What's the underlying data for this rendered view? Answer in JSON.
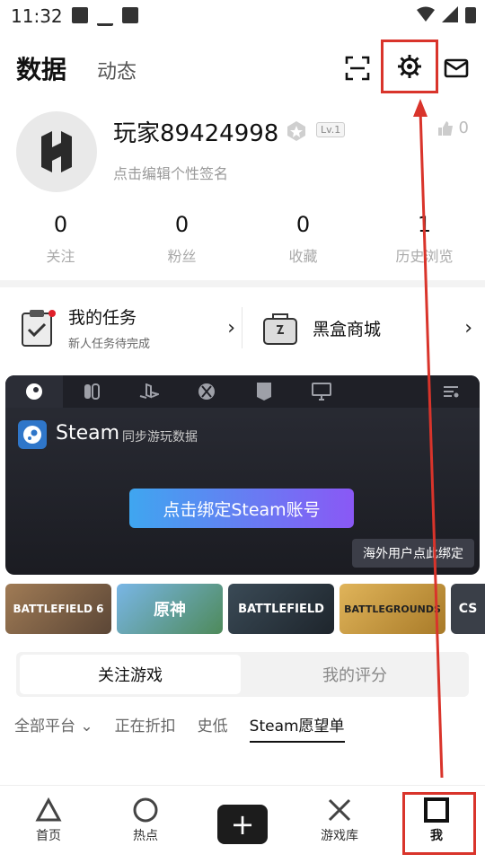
{
  "status": {
    "time": "11:32"
  },
  "header": {
    "tab_active": "数据",
    "tab_inactive": "动态"
  },
  "profile": {
    "username": "玩家89424998",
    "level": "Lv.1",
    "bio": "点击编辑个性签名",
    "likes": "0",
    "stats": [
      {
        "value": "0",
        "label": "关注"
      },
      {
        "value": "0",
        "label": "粉丝"
      },
      {
        "value": "0",
        "label": "收藏"
      },
      {
        "value": "1",
        "label": "历史浏览"
      }
    ]
  },
  "tasks": {
    "left_title": "我的任务",
    "left_sub": "新人任务待完成",
    "right_title": "黑盒商城"
  },
  "panel": {
    "tabs": [
      "steam",
      "switch",
      "playstation",
      "xbox",
      "epic",
      "pc",
      "menu"
    ],
    "title": "Steam",
    "subtitle": "同步游玩数据",
    "bind_button": "点击绑定Steam账号",
    "overseas": "海外用户点此绑定"
  },
  "thumbs": [
    {
      "label": "BATTLEFIELD 6",
      "color": "#8a6a4a"
    },
    {
      "label": "原神",
      "color": "#5b8fbf"
    },
    {
      "label": "BATTLEFIELD",
      "color": "#2e3a44"
    },
    {
      "label": "BATTLEGROUNDS",
      "color": "#c89b3a"
    },
    {
      "label": "CS",
      "color": "#3a3f48"
    }
  ],
  "segmented": {
    "left": "关注游戏",
    "right": "我的评分"
  },
  "filters": [
    "全部平台",
    "正在折扣",
    "史低",
    "Steam愿望单"
  ],
  "nav": [
    {
      "label": "首页"
    },
    {
      "label": "热点"
    },
    {
      "label": "+"
    },
    {
      "label": "游戏库"
    },
    {
      "label": "我"
    }
  ],
  "colors": {
    "annotation": "#d9342b",
    "accent_start": "#3fa6f0",
    "accent_end": "#8a58f5"
  }
}
